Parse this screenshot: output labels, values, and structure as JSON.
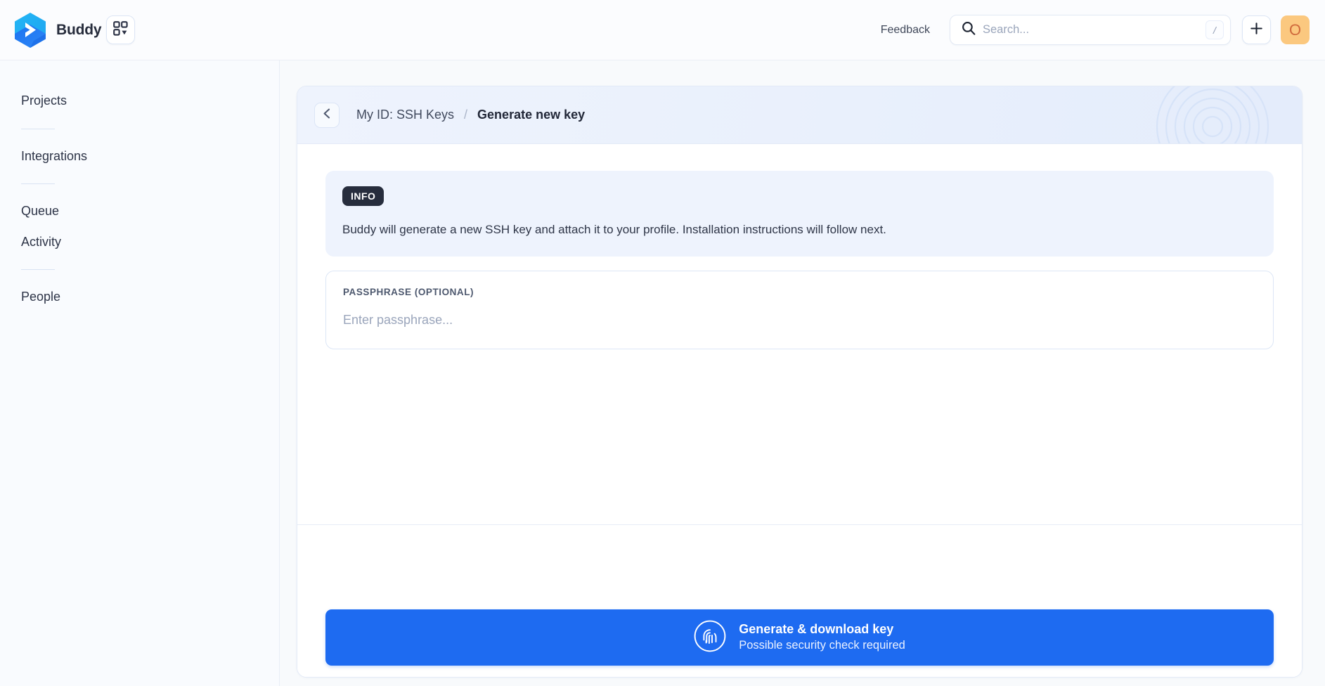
{
  "header": {
    "brand_name": "Buddy",
    "logo_icon": "buddy-hexagon-logo",
    "apps_switcher_icon": "grid-dropdown-icon",
    "feedback_label": "Feedback",
    "search": {
      "icon": "search-icon",
      "placeholder": "Search...",
      "value": "",
      "shortcut_key": "/"
    },
    "add_button_icon": "plus-icon",
    "avatar_initial": "O",
    "avatar_bg_color": "#fbc87f",
    "avatar_text_color": "#d06a3c"
  },
  "sidebar": {
    "items": [
      {
        "label": "Projects",
        "separator_after": true
      },
      {
        "label": "Integrations",
        "separator_after": true
      },
      {
        "label": "Queue",
        "separator_after": false
      },
      {
        "label": "Activity",
        "separator_after": true
      },
      {
        "label": "People",
        "separator_after": false
      }
    ]
  },
  "breadcrumb": {
    "back_icon": "chevron-left-icon",
    "parent_label": "My ID: SSH Keys",
    "separator": "/",
    "current_label": "Generate new key",
    "watermark_icon": "fingerprint-watermark-icon"
  },
  "info_banner": {
    "badge": "INFO",
    "badge_bg_color": "#272d3d",
    "text": "Buddy will generate a new SSH key and attach it to your profile. Installation instructions will follow next."
  },
  "passphrase_field": {
    "label": "PASSPHRASE (OPTIONAL)",
    "placeholder": "Enter passphrase...",
    "value": ""
  },
  "footer": {
    "primary_button": {
      "icon": "fingerprint-icon",
      "title": "Generate & download key",
      "subtitle": "Possible security check required",
      "bg_color": "#1e6bf1"
    }
  }
}
